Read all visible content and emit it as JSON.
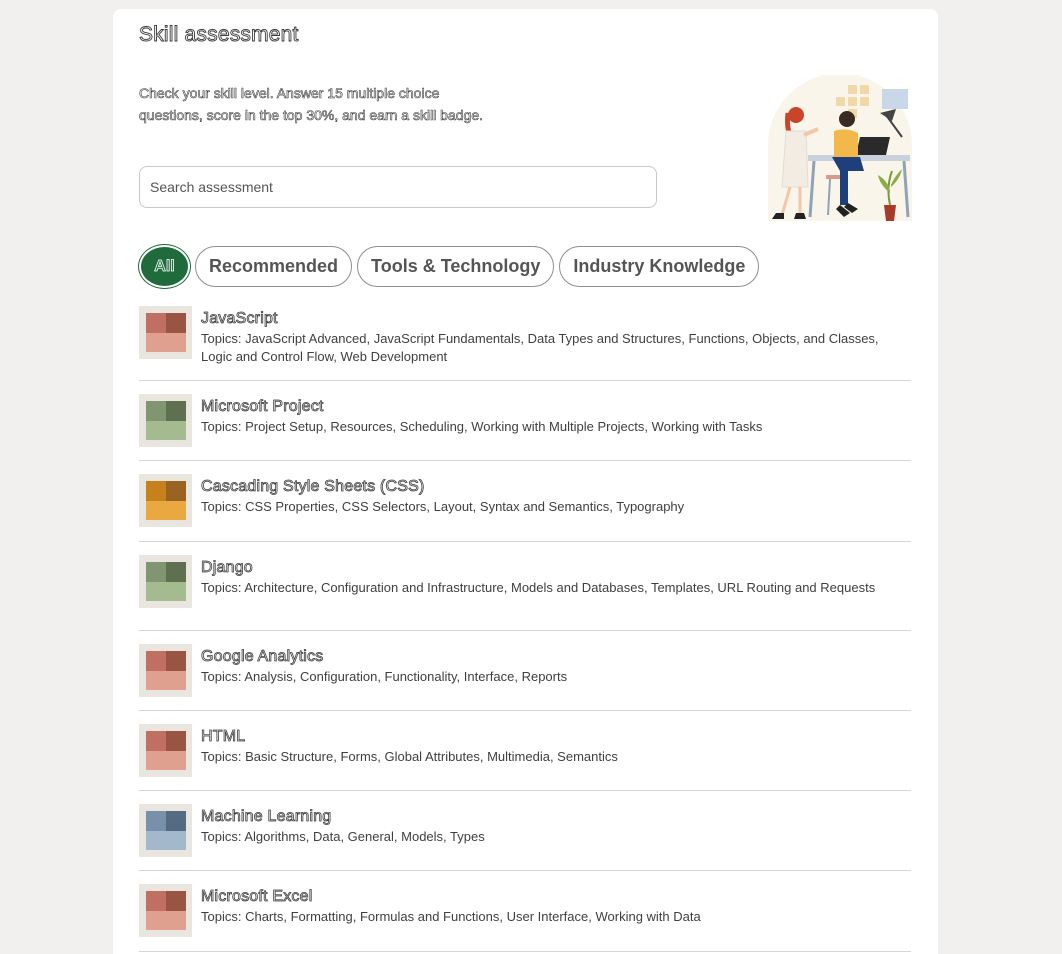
{
  "header": {
    "title": "Skill assessment",
    "description": "Check your skill level. Answer 15 multiple choice questions, score in the top 30%, and earn a skill badge."
  },
  "search": {
    "placeholder": "Search assessment"
  },
  "filters": {
    "all_label": "All",
    "items": [
      "Recommended",
      "Tools & Technology",
      "Industry Knowledge"
    ]
  },
  "assessments": [
    {
      "title": "JavaScript",
      "topics": "Topics: JavaScript Advanced, JavaScript Fundamentals, Data Types and Structures, Functions, Objects, and Classes, Logic and Control Flow, Web Development",
      "colors": [
        "#c07060",
        "#9a5444",
        "#e0a090"
      ]
    },
    {
      "title": "Microsoft Project",
      "topics": "Topics: Project Setup, Resources, Scheduling, Working with Multiple Projects, Working with Tasks",
      "colors": [
        "#7f9670",
        "#5f7050",
        "#a3bb8f"
      ]
    },
    {
      "title": "Cascading Style Sheets (CSS)",
      "topics": "Topics: CSS Properties, CSS Selectors, Layout, Syntax and Semantics, Typography",
      "colors": [
        "#c6801c",
        "#996422",
        "#e9a840"
      ]
    },
    {
      "title": "Django",
      "topics": "Topics: Architecture, Configuration and Infrastructure, Models and Databases, Templates, URL Routing and Requests",
      "colors": [
        "#7f9670",
        "#5f7050",
        "#a3bb8f"
      ]
    },
    {
      "title": "Google Analytics",
      "topics": "Topics: Analysis, Configuration, Functionality, Interface, Reports",
      "colors": [
        "#c07060",
        "#9a5444",
        "#e0a090"
      ]
    },
    {
      "title": "HTML",
      "topics": "Topics: Basic Structure, Forms, Global Attributes, Multimedia, Semantics",
      "colors": [
        "#c07060",
        "#9a5444",
        "#e0a090"
      ]
    },
    {
      "title": "Machine Learning",
      "topics": "Topics: Algorithms, Data, General, Models, Types",
      "colors": [
        "#7890aa",
        "#566a82",
        "#a4b8cc"
      ]
    },
    {
      "title": "Microsoft Excel",
      "topics": "Topics: Charts, Formatting, Formulas and Functions, User Interface, Working with Data",
      "colors": [
        "#c07060",
        "#9a5444",
        "#e0a090"
      ]
    }
  ]
}
